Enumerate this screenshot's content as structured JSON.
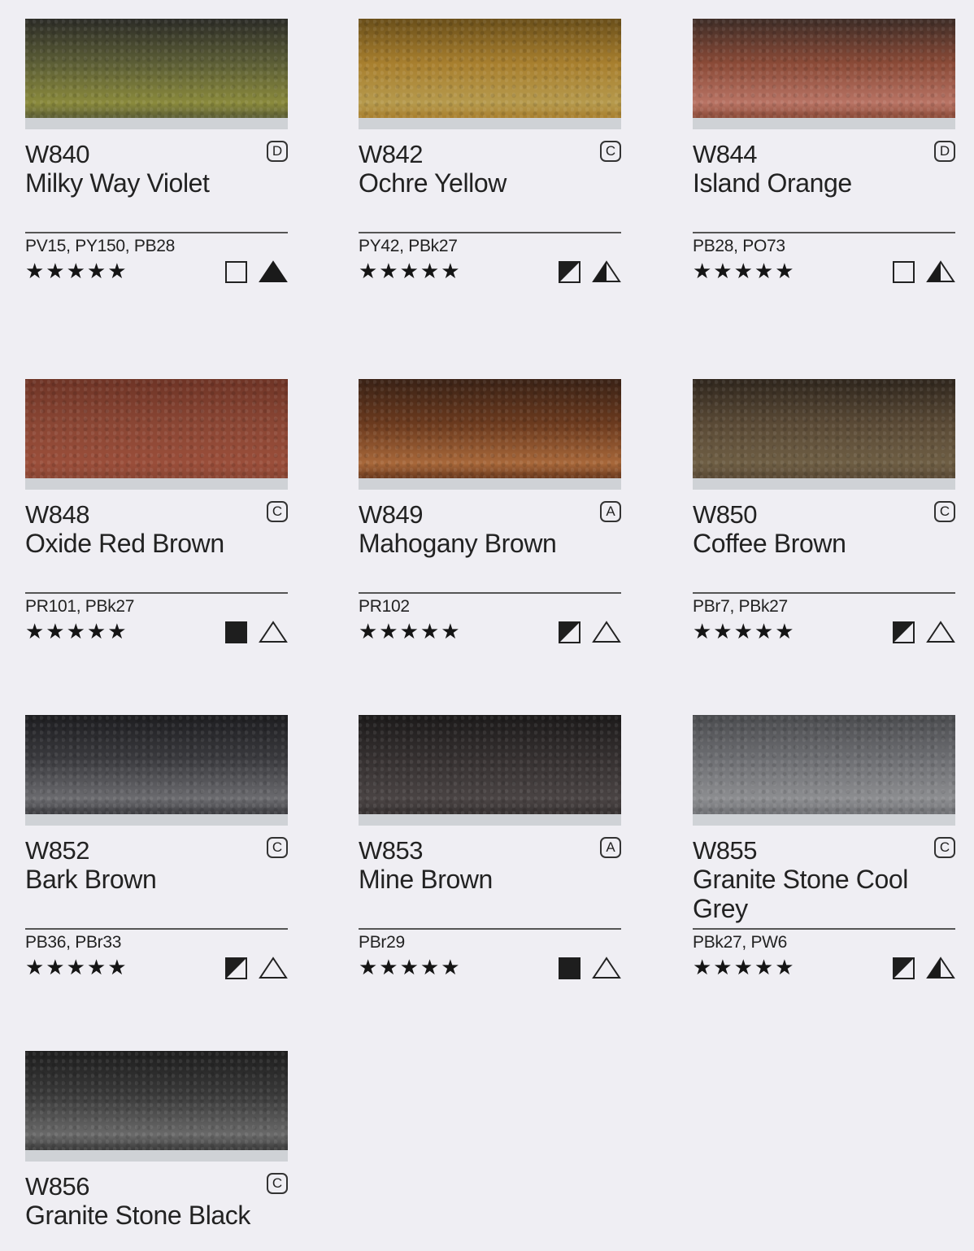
{
  "colors": [
    {
      "code": "W840",
      "name": "Milky Way Violet",
      "permanence": "D",
      "pigments": "PV15, PY150, PB28",
      "rating": "★★★★★",
      "opacity": "transparent",
      "staining": "high",
      "swatch": [
        "#2c2c27",
        "#5c5e36",
        "#8a8a3c"
      ]
    },
    {
      "code": "W842",
      "name": "Ochre Yellow",
      "permanence": "C",
      "pigments": "PY42, PBk27",
      "rating": "★★★★★",
      "opacity": "semi",
      "staining": "medium",
      "swatch": [
        "#6a4f1a",
        "#a87f2e",
        "#b69a4d"
      ]
    },
    {
      "code": "W844",
      "name": "Island Orange",
      "permanence": "D",
      "pigments": "PB28, PO73",
      "rating": "★★★★★",
      "opacity": "transparent",
      "staining": "medium",
      "swatch": [
        "#3e2d27",
        "#8a4a37",
        "#b97465"
      ]
    },
    {
      "code": "W848",
      "name": "Oxide Red Brown",
      "permanence": "C",
      "pigments": "PR101, PBk27",
      "rating": "★★★★★",
      "opacity": "opaque",
      "staining": "low",
      "swatch": [
        "#6e3426",
        "#8a4634",
        "#9a4e3a"
      ]
    },
    {
      "code": "W849",
      "name": "Mahogany Brown",
      "permanence": "A",
      "pigments": "PR102",
      "rating": "★★★★★",
      "opacity": "semi",
      "staining": "low",
      "swatch": [
        "#3a2216",
        "#6b3a1e",
        "#a8683a"
      ]
    },
    {
      "code": "W850",
      "name": "Coffee Brown",
      "permanence": "C",
      "pigments": "PBr7, PBk27",
      "rating": "★★★★★",
      "opacity": "semi",
      "staining": "low",
      "swatch": [
        "#2f261d",
        "#5a4a36",
        "#6e5e44"
      ]
    },
    {
      "code": "W852",
      "name": "Bark Brown",
      "permanence": "C",
      "pigments": "PB36, PBr33",
      "rating": "★★★★★",
      "opacity": "semi",
      "staining": "low",
      "swatch": [
        "#1d1d20",
        "#3b3b3f",
        "#6c6c70"
      ]
    },
    {
      "code": "W853",
      "name": "Mine Brown",
      "permanence": "A",
      "pigments": "PBr29",
      "rating": "★★★★★",
      "opacity": "opaque",
      "staining": "low",
      "swatch": [
        "#1c1a1a",
        "#363131",
        "#4a4444"
      ]
    },
    {
      "code": "W855",
      "name": "Granite Stone Cool Grey",
      "permanence": "C",
      "pigments": "PBk27, PW6",
      "rating": "★★★★★",
      "opacity": "semi",
      "staining": "medium",
      "swatch": [
        "#4a4b4e",
        "#6e6f73",
        "#8d8e91"
      ]
    },
    {
      "code": "W856",
      "name": "Granite Stone Black",
      "permanence": "C",
      "pigments": "",
      "rating": "",
      "opacity": "",
      "staining": "",
      "swatch": [
        "#1e1e1e",
        "#3a3a3a",
        "#6a6a6a"
      ]
    }
  ]
}
